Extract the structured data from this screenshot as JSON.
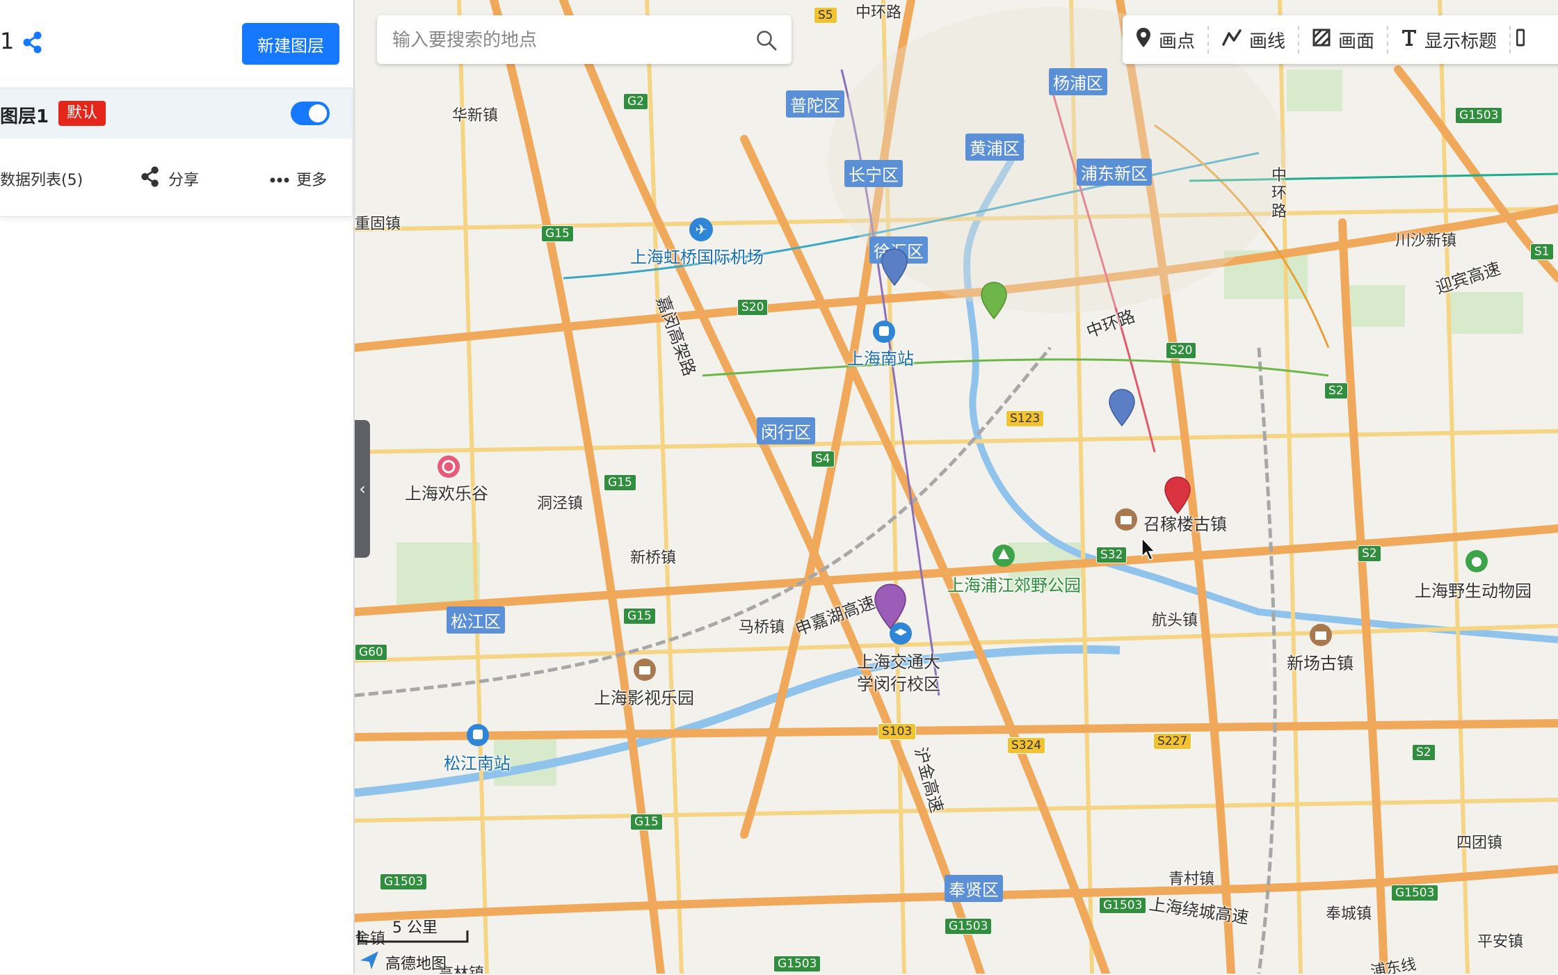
{
  "panel": {
    "layer_name_truncated": "1",
    "new_layer_label": "新建图层",
    "layer": {
      "title": "图层1",
      "badge": "默认",
      "visible": true
    },
    "actions": {
      "data_list": "数据列表(5)",
      "share": "分享",
      "more": "更多"
    }
  },
  "search": {
    "placeholder": "输入要搜索的地点"
  },
  "toolbar": {
    "point": "画点",
    "line": "画线",
    "polygon": "画面",
    "show_title": "显示标题"
  },
  "map": {
    "districts": {
      "putuo": "普陀区",
      "yangpu": "杨浦区",
      "huangpu": "黄浦区",
      "changning": "长宁区",
      "pudong": "浦东新区",
      "xuhui": "徐汇区",
      "minhang": "闵行区",
      "songjiang": "松江区",
      "fengxian": "奉贤区"
    },
    "places": {
      "zhonghuanlu_top": "中环路",
      "huaxin": "华新镇",
      "chonggu": "重固镇",
      "hongqiao_airport": "上海虹桥国际机场",
      "shanghai_south": "上海南站",
      "jiamin_elevated": "嘉闵高架路",
      "zhonghuan_mid": "中环路",
      "zhonghuan_vertical": "中环路",
      "chuansha": "川沙新镇",
      "yingbin": "迎宾高速",
      "happy_valley": "上海欢乐谷",
      "dongjing": "洞泾镇",
      "xinqiao": "新桥镇",
      "zhaojialou": "召稼楼古镇",
      "pujiang_park": "上海浦江郊野公园",
      "wildlife_park": "上海野生动物园",
      "maqiao": "马桥镇",
      "shenjiahu": "申嘉湖高速",
      "sjtu_1": "上海交通大",
      "sjtu_2": "学闵行校区",
      "hangtou": "航头镇",
      "xinchang": "新场古镇",
      "film_park": "上海影视乐园",
      "songjiang_south": "松江南站",
      "hujin": "沪金高速",
      "situan": "四团镇",
      "qingcun": "青村镇",
      "raocheng": "上海绕城高速",
      "fengcheng": "奉城镇",
      "pingan": "平安镇",
      "pudong_east": "浦东线",
      "sheting": "舍镇",
      "gaolin": "高林镇"
    },
    "shields": {
      "s5": "S5",
      "g2": "G2",
      "g15_a": "G15",
      "s20_a": "S20",
      "s20_b": "S20",
      "g1503_a": "G1503",
      "s1": "S1",
      "s2_a": "S2",
      "s123": "S123",
      "s4": "S4",
      "g15_b": "G15",
      "s32": "S32",
      "s2_b": "S2",
      "g15_c": "G15",
      "g60": "G60",
      "s103": "S103",
      "s324": "S324",
      "s227": "S227",
      "s2_c": "S2",
      "g15_d": "G15",
      "g1503_b": "G1503",
      "g1503_c": "G1503",
      "g1503_d": "G1503",
      "g1503_e": "G1503",
      "g1503_f": "G1503"
    },
    "pins": [
      {
        "color": "#5b7fc7"
      },
      {
        "color": "#6fb64a"
      },
      {
        "color": "#5b7fc7"
      },
      {
        "color": "#d9333f"
      },
      {
        "color": "#9b5db8"
      }
    ],
    "scale": "5 公里",
    "logo": "高德地图"
  }
}
